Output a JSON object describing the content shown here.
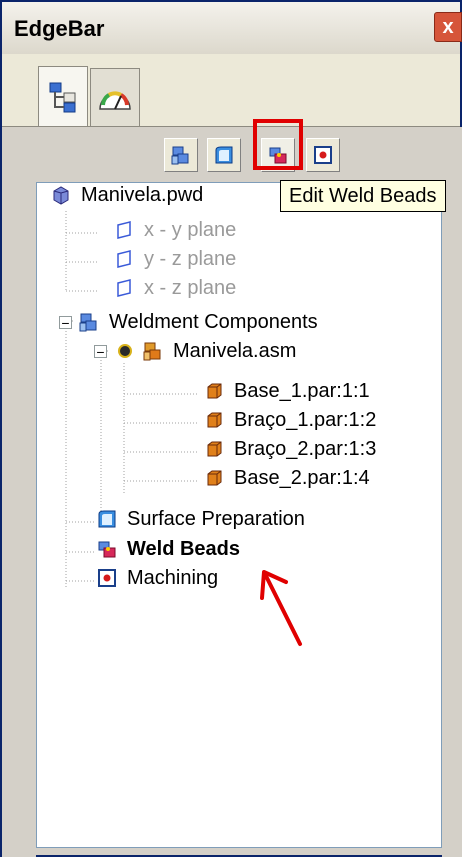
{
  "window": {
    "title": "EdgeBar",
    "close_glyph": "x"
  },
  "tabs": [
    {
      "icon": "pathfinder-tree-icon",
      "active": true
    },
    {
      "icon": "gauge-icon",
      "active": false
    }
  ],
  "toolbar": {
    "buttons": [
      {
        "icon": "weldment-components-icon"
      },
      {
        "icon": "surface-preparation-icon"
      },
      {
        "icon": "weld-beads-icon",
        "highlighted": true
      },
      {
        "icon": "machining-icon"
      }
    ],
    "tooltip": "Edit Weld Beads"
  },
  "tree": {
    "root": "Manivela.pwd",
    "planes": [
      "x - y plane",
      "y - z plane",
      "x - z plane"
    ],
    "weldment": "Weldment Components",
    "assembly": "Manivela.asm",
    "parts": [
      "Base_1.par:1:1",
      "Braço_1.par:1:2",
      "Braço_2.par:1:3",
      "Base_2.par:1:4"
    ],
    "surface_prep": "Surface Preparation",
    "weld_beads": "Weld Beads",
    "machining": "Machining",
    "expander_glyph": "−"
  },
  "colors": {
    "highlight": "#e00000",
    "annotation_arrow": "#e00000",
    "plane_text": "#9a9a9a",
    "tooltip_bg": "#ffffe1"
  }
}
